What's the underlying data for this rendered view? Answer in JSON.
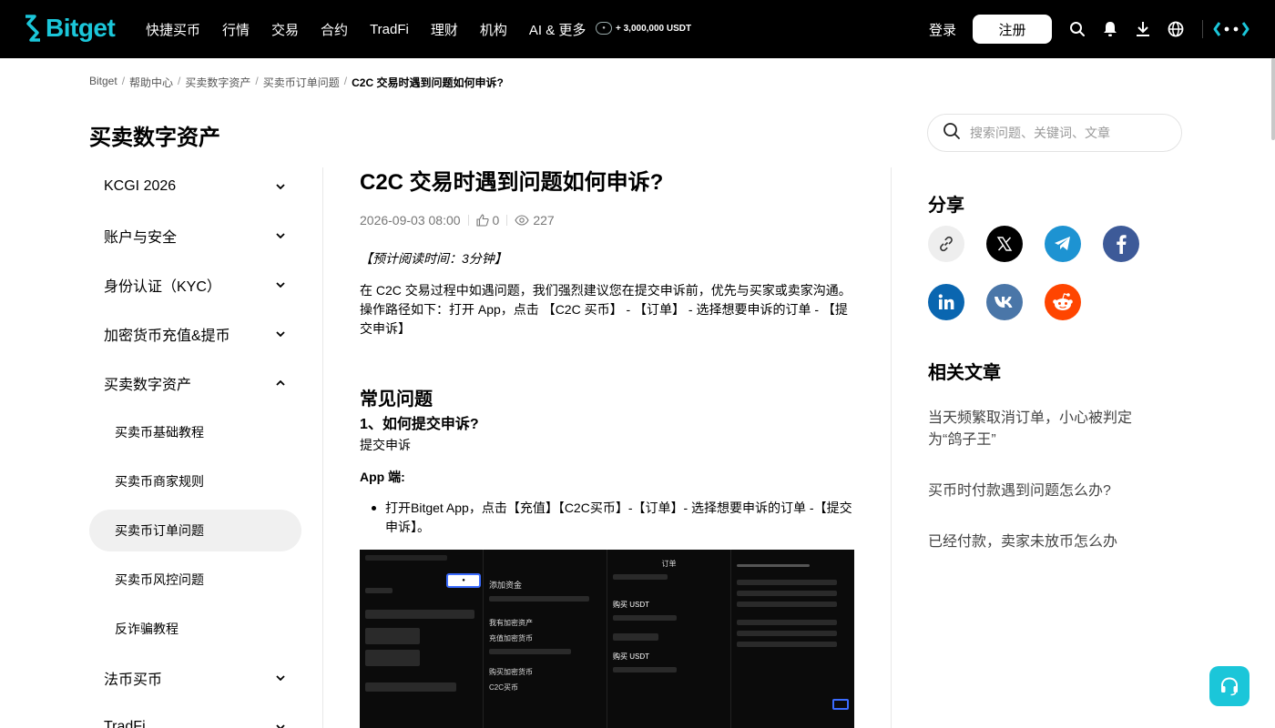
{
  "nav": {
    "logo": "Bitget",
    "items": [
      "快捷买币",
      "行情",
      "交易",
      "合约",
      "TradFi",
      "理财",
      "机构",
      "AI & 更多"
    ],
    "promo": "+ 3,000,000 USDT",
    "login": "登录",
    "register": "注册"
  },
  "breadcrumb": {
    "items": [
      "Bitget",
      "帮助中心",
      "买卖数字资产",
      "买卖币订单问题"
    ],
    "current": "C2C 交易时遇到问题如何申诉?"
  },
  "sidebar": {
    "title": "买卖数字资产",
    "items": [
      "KCGI 2026",
      "账户与安全",
      "身份认证（KYC）",
      "加密货币充值&提币",
      "买卖数字资产"
    ],
    "sub_items": [
      "买卖币基础教程",
      "买卖币商家规则",
      "买卖币订单问题",
      "买卖币风控问题",
      "反诈骗教程"
    ],
    "active_sub": "买卖币订单问题",
    "after_items": [
      "法币买币",
      "TradFi"
    ]
  },
  "article": {
    "title": "C2C 交易时遇到问题如何申诉?",
    "date": "2026-09-03 08:00",
    "likes": "0",
    "views": "227",
    "reading_time": "【预计阅读时间：3分钟】",
    "intro": "在 C2C 交易过程中如遇问题，我们强烈建议您在提交申诉前，优先与买家或卖家沟通。操作路径如下：打开 App，点击 【C2C 买币】 - 【订单】 - 选择想要申诉的订单 - 【提交申诉】",
    "faq_title": "常见问题",
    "q1": "1、如何提交申诉?",
    "q1_answer": "提交申诉",
    "app_label": "App 端:",
    "bullet": "打开Bitget App，点击【充值】【C2C买币】-【订单】- 选择想要申诉的订单 -【提交申诉】。",
    "screens": {
      "s2_title": "添加资金",
      "s2_a": "我有加密资产",
      "s2_b": "充值加密货币",
      "s2_c": "购买加密货币",
      "s2_d": "C2C买币",
      "s3_title": "订单",
      "s3_a": "购买 USDT",
      "s3_b": "购买 USDT"
    }
  },
  "search": {
    "placeholder": "搜索问题、关键词、文章"
  },
  "share": {
    "title": "分享",
    "icons": [
      "link-icon",
      "x-icon",
      "telegram-icon",
      "facebook-icon",
      "linkedin-icon",
      "vk-icon",
      "reddit-icon"
    ]
  },
  "related": {
    "title": "相关文章",
    "items": [
      "当天频繁取消订单，小心被判定为“鸽子王”",
      "买币时付款遇到问题怎么办?",
      "已经付款，卖家未放币怎么办"
    ]
  },
  "colors": {
    "brand": "#1bc6d9",
    "telegram": "#1d93d2",
    "facebook": "#3d5a98",
    "linkedin": "#0a66b0",
    "vk": "#4a76a8",
    "reddit": "#ff4500"
  }
}
